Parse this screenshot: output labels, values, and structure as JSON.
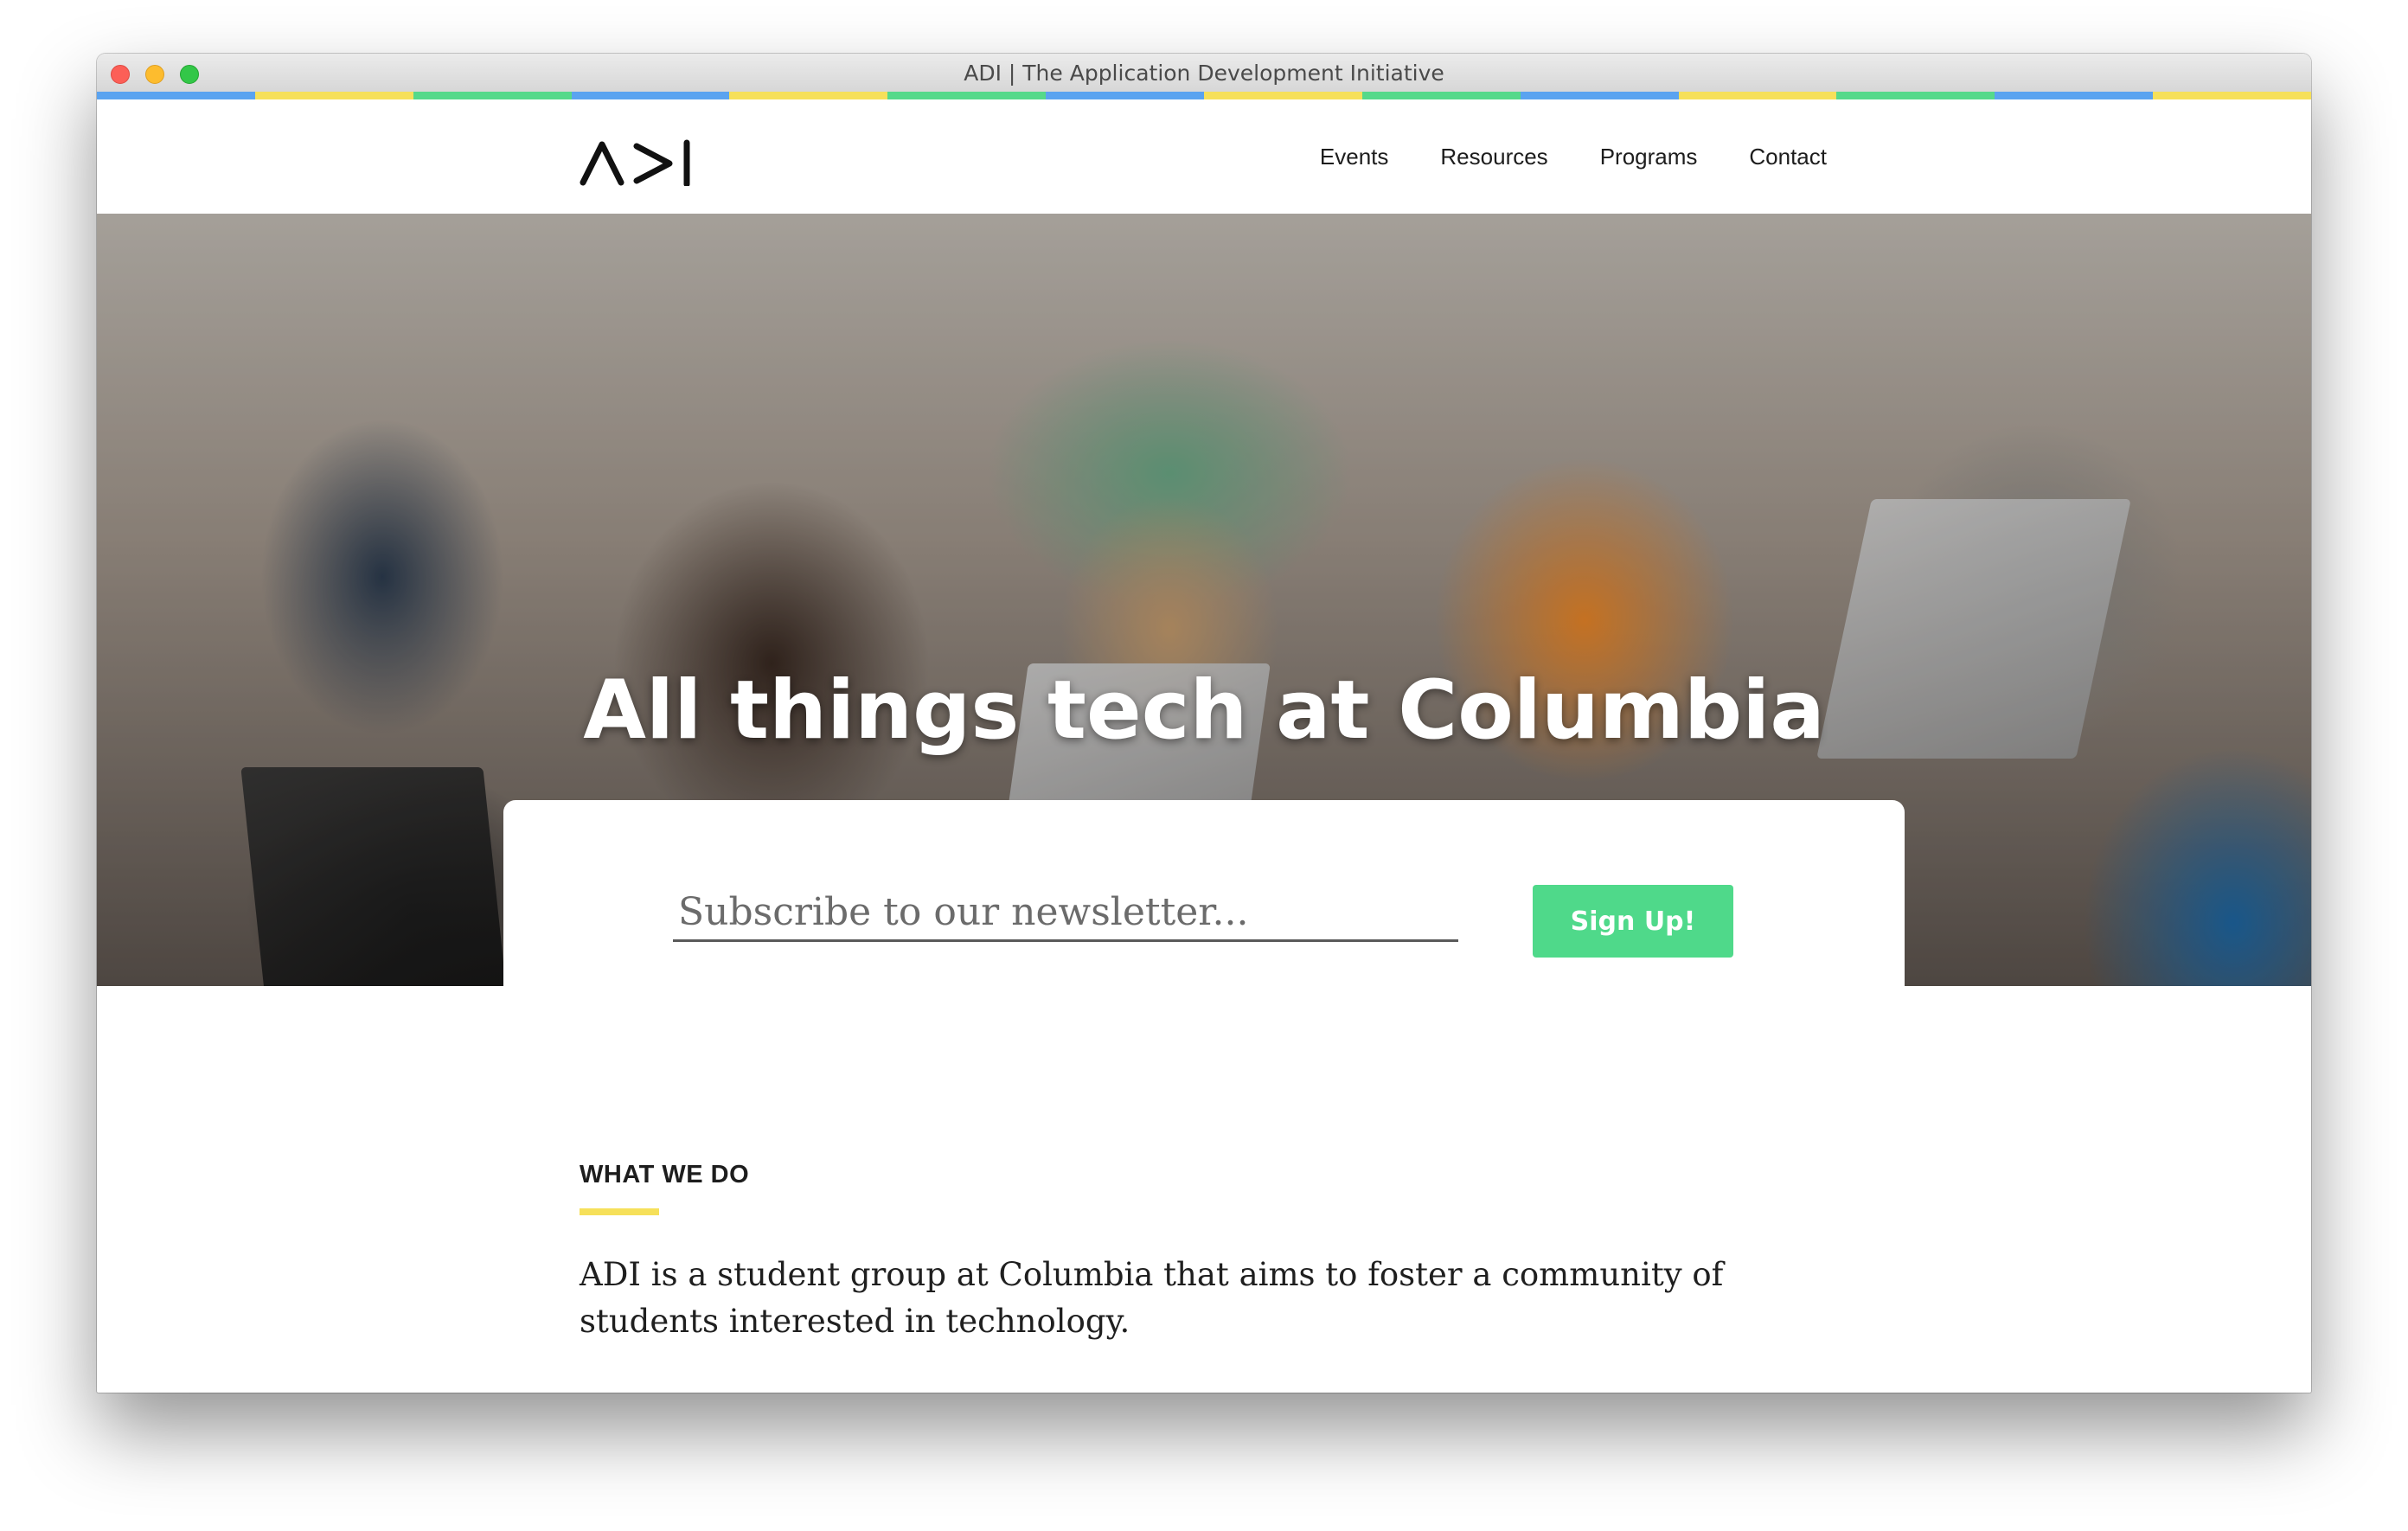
{
  "window": {
    "title": "ADI | The Application Development Initiative"
  },
  "stripe_colors": [
    "#5aa3f0",
    "#f6e05a",
    "#55d98a",
    "#5aa3f0",
    "#f6e05a",
    "#55d98a",
    "#5aa3f0",
    "#f6e05a",
    "#55d98a",
    "#5aa3f0",
    "#f6e05a",
    "#55d98a",
    "#5aa3f0",
    "#f6e05a"
  ],
  "header": {
    "logo_alt": "ADI",
    "nav": [
      {
        "label": "Events"
      },
      {
        "label": "Resources"
      },
      {
        "label": "Programs"
      },
      {
        "label": "Contact"
      }
    ]
  },
  "hero": {
    "title": "All things tech at Columbia"
  },
  "newsletter": {
    "placeholder": "Subscribe to our newsletter...",
    "button_label": "Sign Up!",
    "button_color": "#4fd98a"
  },
  "about": {
    "label": "WHAT WE DO",
    "accent_color": "#f6e05a",
    "text": "ADI is a student group at Columbia that aims to foster a community of students interested in technology."
  }
}
